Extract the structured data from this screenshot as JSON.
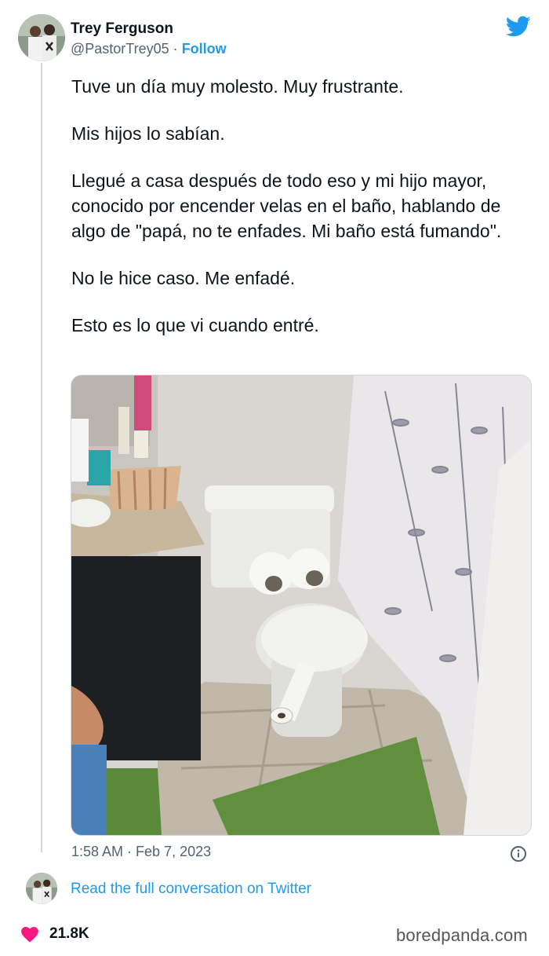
{
  "author": {
    "name": "Trey Ferguson",
    "handle": "@PastorTrey05",
    "separator": "·",
    "follow_label": "Follow"
  },
  "tweet": {
    "paragraphs": [
      "Tuve un día muy molesto. Muy frustrante.",
      "Mis hijos lo sabían.",
      "Llegué a casa después de todo eso y mi hijo mayor, conocido por encender velas en el baño, hablando de algo de \"papá, no te enfades. Mi baño está fumando\".",
      "No le hice caso. Me enfadé.",
      "Esto es lo que vi cuando entré."
    ],
    "timestamp": "1:58 AM · Feb 7, 2023",
    "read_link": "Read the full conversation on Twitter",
    "likes": "21.8K"
  },
  "watermark": "boredpanda.com",
  "colors": {
    "accent": "#1d9bf0",
    "like": "#f91880",
    "text": "#0f1419",
    "muted": "#536471"
  },
  "icons": [
    "twitter-bird-icon",
    "info-icon",
    "heart-icon"
  ]
}
